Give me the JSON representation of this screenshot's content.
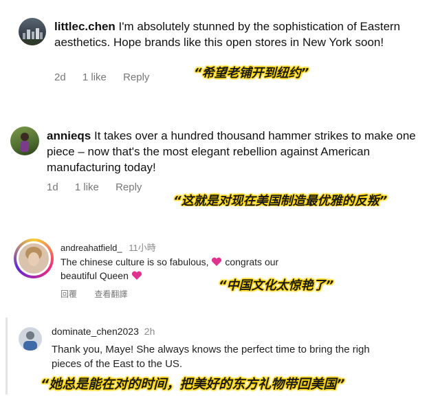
{
  "comments": [
    {
      "username": "littlec.chen",
      "text": "I'm absolutely stunned by the sophistication of Eastern aesthetics. Hope brands like this open stores in New York soon!",
      "time": "2d",
      "likes": "1 like",
      "reply": "Reply",
      "caption": "“希望老铺开到纽约”"
    },
    {
      "username": "annieqs",
      "text": "It takes over a hundred thousand hammer strikes to make one piece – now that's the most elegant rebellion against American manufacturing today!",
      "time": "1d",
      "likes": "1 like",
      "reply": "Reply",
      "caption": "“这就是对现在美国制造最优雅的反叛”"
    },
    {
      "username": "andreahatfield_",
      "time": "11小時",
      "text_part1": "The chinese culture is so fabulous,",
      "text_part2": "congrats our",
      "text_part3": "beautiful Queen",
      "reply": "回覆",
      "translate": "查看翻譯",
      "caption": "“中国文化太惊艳了”"
    },
    {
      "username": "dominate_chen2023",
      "time": "2h",
      "text_line1": "Thank you, Maye! She always knows the perfect time to bring the righ",
      "text_line2": "pieces of the East to the US.",
      "caption": "“她总是能在对的时间，把美好的东方礼物带回美国”"
    }
  ],
  "colors": {
    "caption_glow": "#ffd400",
    "heart": "#e0338f",
    "meta": "#777777"
  }
}
